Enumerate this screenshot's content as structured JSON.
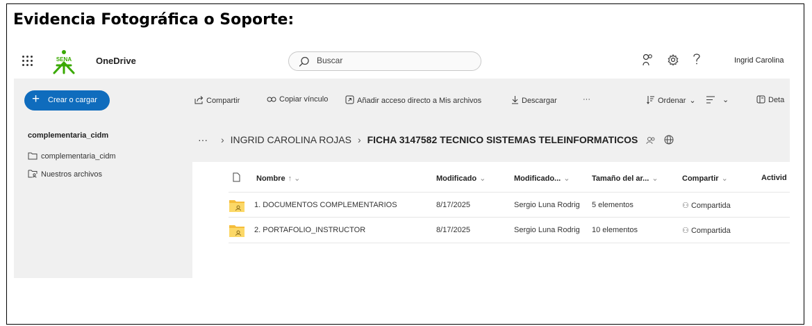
{
  "document": {
    "title": "Evidencia Fotográfica o Soporte:"
  },
  "topbar": {
    "logo_text": "SENA",
    "app_name": "OneDrive",
    "search_placeholder": "Buscar",
    "user_name": "Ingrid Carolina",
    "icons": [
      "waffle-icon",
      "people-icon",
      "settings-icon",
      "help-icon"
    ]
  },
  "sidebar": {
    "create_button": "Crear o cargar",
    "section_title": "complementaria_cidm",
    "items": [
      {
        "label": "complementaria_cidm",
        "icon": "folder-icon"
      },
      {
        "label": "Nuestros archivos",
        "icon": "shared-files-icon"
      }
    ]
  },
  "commands": {
    "share": "Compartir",
    "copy_link": "Copiar vínculo",
    "add_shortcut": "Añadir acceso directo a Mis archivos",
    "download": "Descargar",
    "more": "···",
    "sort": "Ordenar",
    "view": "",
    "details": "Deta"
  },
  "breadcrumb": {
    "more": "···",
    "parent": "INGRID CAROLINA ROJAS",
    "current": "FICHA 3147582 TECNICO SISTEMAS TELEINFORMATICOS"
  },
  "table": {
    "columns": {
      "name": "Nombre",
      "modified": "Modificado",
      "modified_by": "Modificado...",
      "size": "Tamaño del ar...",
      "sharing": "Compartir",
      "activity": "Activid"
    },
    "rows": [
      {
        "name": "1. DOCUMENTOS COMPLEMENTARIOS",
        "modified": "8/17/2025",
        "modified_by": "Sergio Luna Rodrig",
        "size": "5 elementos",
        "sharing": "Compartida"
      },
      {
        "name": "2. PORTAFOLIO_INSTRUCTOR",
        "modified": "8/17/2025",
        "modified_by": "Sergio Luna Rodrig",
        "size": "10 elementos",
        "sharing": "Compartida"
      }
    ]
  },
  "colors": {
    "accent": "#0f6cbd",
    "folder": "#f5bd3b",
    "sena_green": "#39a900",
    "sidebar_bg": "#f0f0f0"
  }
}
